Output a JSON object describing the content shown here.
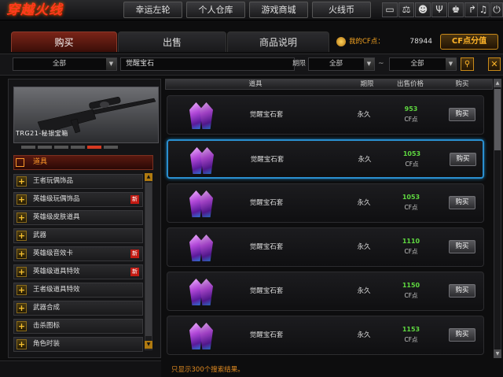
{
  "app": {
    "logo_text": "穿越火线"
  },
  "nav": {
    "items": [
      "幸运左轮",
      "个人仓库",
      "游戏商城",
      "火线币"
    ]
  },
  "toolbar_icons": [
    "tv-icon",
    "scale-icon",
    "mask-icon",
    "antlers-icon",
    "trophy-icon",
    "arrow-icon",
    "headset-icon",
    "power-icon"
  ],
  "tabs": [
    "购买",
    "出售",
    "商品说明"
  ],
  "balance": {
    "label": "我的CF点：",
    "value": "78944",
    "recharge": "CF点分值"
  },
  "filters": {
    "category": "全部",
    "search": "觉醒宝石",
    "period_label": "期限",
    "period_from": "全部",
    "tilde": "~",
    "period_to": "全部"
  },
  "weapon": {
    "name": "TRG21-秘银宝箱"
  },
  "category_header": "道具",
  "categories": [
    {
      "label": "王者玩偶饰品",
      "new": false
    },
    {
      "label": "英雄级玩偶饰品",
      "new": true
    },
    {
      "label": "英雄级皮肤道具",
      "new": false
    },
    {
      "label": "武器",
      "new": false
    },
    {
      "label": "英雄级音效卡",
      "new": true
    },
    {
      "label": "英雄级道具特效",
      "new": true
    },
    {
      "label": "王者级道具特效",
      "new": false
    },
    {
      "label": "武器合成",
      "new": false
    },
    {
      "label": "击杀图标",
      "new": false
    },
    {
      "label": "角色时装",
      "new": false
    }
  ],
  "new_badge": "新",
  "table": {
    "headers": [
      "道具",
      "期限",
      "出售价格",
      "购买"
    ],
    "rows": [
      {
        "name": "觉醒宝石套",
        "period": "永久",
        "price": "953",
        "unit": "CF点",
        "buy": "购买"
      },
      {
        "name": "觉醒宝石套",
        "period": "永久",
        "price": "1053",
        "unit": "CF点",
        "buy": "购买"
      },
      {
        "name": "觉醒宝石套",
        "period": "永久",
        "price": "1053",
        "unit": "CF点",
        "buy": "购买"
      },
      {
        "name": "觉醒宝石套",
        "period": "永久",
        "price": "1110",
        "unit": "CF点",
        "buy": "购买"
      },
      {
        "name": "觉醒宝石套",
        "period": "永久",
        "price": "1150",
        "unit": "CF点",
        "buy": "购买"
      },
      {
        "name": "觉醒宝石套",
        "period": "永久",
        "price": "1153",
        "unit": "CF点",
        "buy": "购买"
      }
    ]
  },
  "footer_note": "只显示300个搜索结果。",
  "colors": {
    "accent": "#ffb429",
    "price": "#5fd940",
    "selected_border": "#2a8fd0",
    "tab_active": "#7a2418"
  }
}
